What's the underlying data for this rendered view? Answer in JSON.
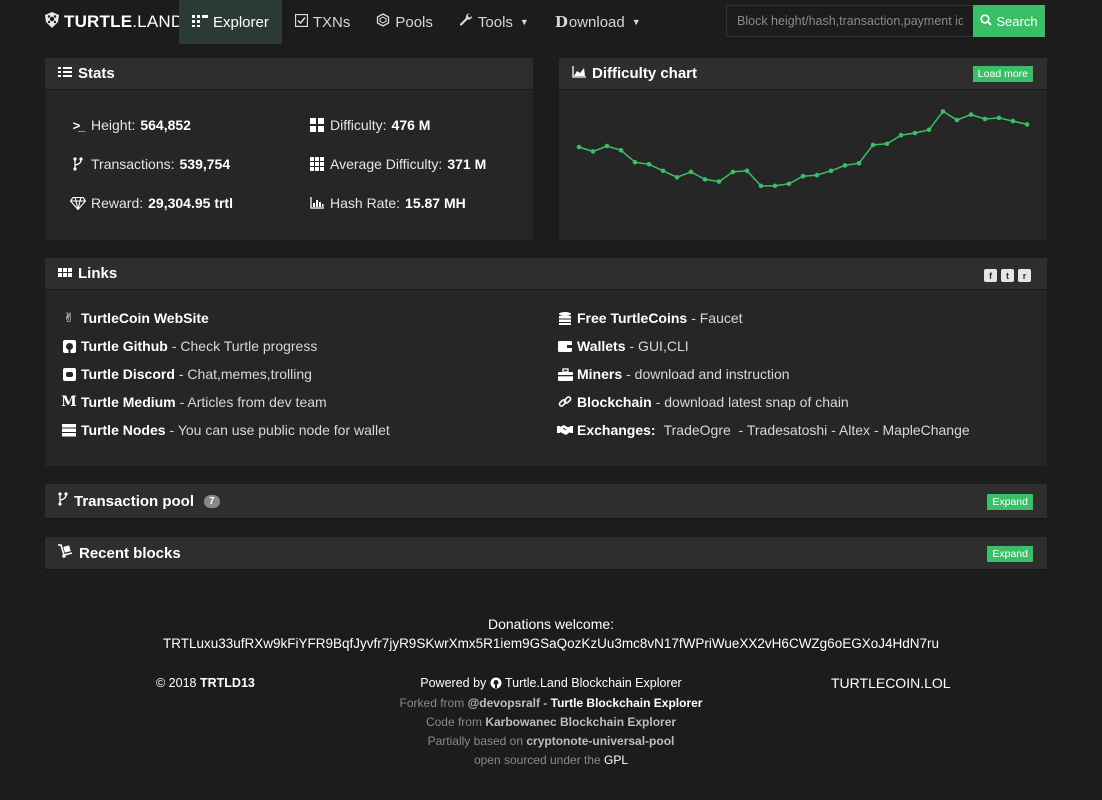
{
  "nav": {
    "brand_bold": "TURTLE",
    "brand_thin": ".LAND",
    "items": [
      {
        "label": "Explorer",
        "icon": "grid-icon"
      },
      {
        "label": "TXNs",
        "icon": "check-square-icon"
      },
      {
        "label": "Pools",
        "icon": "hexagon-icon"
      },
      {
        "label": "Tools",
        "icon": "wrench-icon"
      },
      {
        "label": "ownload",
        "icon": "d-icon"
      }
    ],
    "search_placeholder": "Block height/hash,transaction,payment id",
    "search_label": "Search"
  },
  "stats": {
    "title": "Stats",
    "height_label": "Height:",
    "height_value": "564,852",
    "difficulty_label": "Difficulty:",
    "difficulty_value": "476 M",
    "transactions_label": "Transactions:",
    "transactions_value": "539,754",
    "avg_difficulty_label": "Average Difficulty:",
    "avg_difficulty_value": "371 M",
    "reward_label": "Reward:",
    "reward_value": "29,304.95 trtl",
    "hashrate_label": "Hash Rate:",
    "hashrate_value": "15.87 MH"
  },
  "difficulty_chart": {
    "title": "Difficulty chart",
    "load_more": "Load more",
    "line_color": "#3bbf66"
  },
  "chart_data": {
    "type": "line",
    "title": "Difficulty chart",
    "xlabel": "",
    "ylabel": "",
    "grid": false,
    "y_relative": [
      0.62,
      0.58,
      0.63,
      0.59,
      0.48,
      0.46,
      0.4,
      0.34,
      0.39,
      0.32,
      0.3,
      0.39,
      0.4,
      0.26,
      0.26,
      0.28,
      0.35,
      0.36,
      0.4,
      0.45,
      0.47,
      0.64,
      0.65,
      0.73,
      0.75,
      0.78,
      0.95,
      0.87,
      0.92,
      0.88,
      0.89,
      0.86,
      0.83
    ]
  },
  "links": {
    "title": "Links",
    "left": [
      {
        "title": "TurtleCoin WebSite",
        "desc": ""
      },
      {
        "title": "Turtle Github",
        "desc": "- Check Turtle progress"
      },
      {
        "title": "Turtle Discord",
        "desc": "- Chat,memes,trolling"
      },
      {
        "title": "Turtle Medium",
        "desc": "- Articles from dev team"
      },
      {
        "title": "Turtle Nodes",
        "desc": "- You can use public node for wallet"
      }
    ],
    "right": [
      {
        "title": "Free TurtleCoins",
        "desc": "- Faucet"
      },
      {
        "title": "Wallets",
        "desc": "- GUI,CLI"
      },
      {
        "title": "Miners",
        "desc": "- download and instruction"
      },
      {
        "title": "Blockchain",
        "desc": "- download latest snap of chain"
      },
      {
        "title": "Exchanges:",
        "desc": "TradeOgre  - Tradesatoshi - Altex - MapleChange"
      }
    ]
  },
  "pool": {
    "title": "Transaction pool",
    "count": "7",
    "expand": "Expand"
  },
  "recent": {
    "title": "Recent blocks",
    "expand": "Expand"
  },
  "footer": {
    "donations": "Donations welcome:",
    "address": "TRTLuxu33ufRXw9kFiYFR9BqfJyvfr7jyR9SKwrXmx5R1iem9GSaQozKzUu3mc8vN17fWPriWueXX2vH6CWZg6oEGXoJ4HdN7ru",
    "copyright": "© 2018",
    "copyright_owner": "TRTLD13",
    "powered_by": "Powered by",
    "powered_name": "Turtle.Land Blockchain Explorer",
    "forked_from": "Forked from",
    "forked_user": "@devopsralf",
    "forked_dash": "-",
    "forked_project": "Turtle Blockchain Explorer",
    "code_from": "Code from",
    "code_project": "Karbowanec Blockchain Explorer",
    "partially": "Partially based on",
    "partially_project": "cryptonote-universal-pool",
    "open_sourced": "open sourced under the",
    "license": "GPL",
    "right_link": "TURTLECOIN.LOL"
  }
}
